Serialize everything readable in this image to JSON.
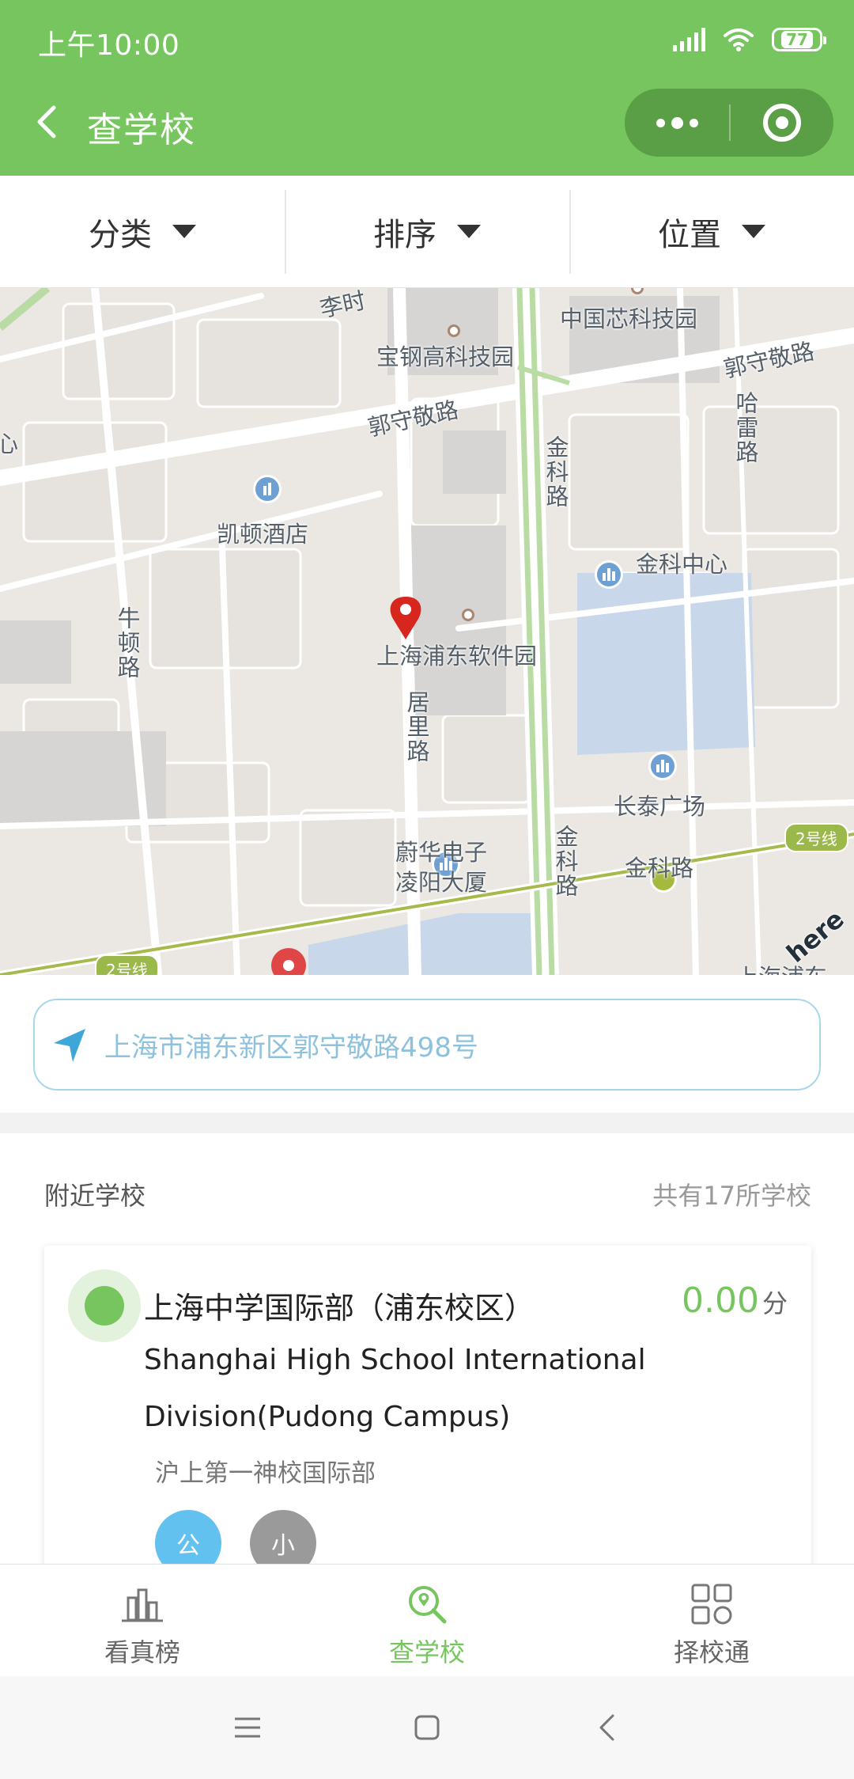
{
  "status": {
    "time": "上午10:00",
    "battery": "77"
  },
  "header": {
    "title": "查学校"
  },
  "filters": [
    {
      "label": "分类"
    },
    {
      "label": "排序"
    },
    {
      "label": "位置"
    }
  ],
  "map": {
    "labels": {
      "lixi": "李时",
      "zhongguoxin": "中国芯科技园",
      "baogang": "宝钢高科技园",
      "guoshoujing_ne": "郭守敬路",
      "guoshoujing_mid": "郭守敬路",
      "kaidun": "凯顿酒店",
      "halei": "哈雷路",
      "jinke_road_1": "金科路",
      "jinke_center": "金科中心",
      "niudun": "牛顿路",
      "pudong_soft": "上海浦东软件园",
      "juli": "居里路",
      "changtai": "长泰广场",
      "weihua": "蔚华电子",
      "lingyang": "凌阳大厦",
      "jinke_road_2": "金科路",
      "jinke_station": "金科路",
      "line2_a": "2号线",
      "line2_b": "2号线",
      "left_edge": "心",
      "bottom_right": "上海浦东",
      "here": "here"
    }
  },
  "address": {
    "text": "上海市浦东新区郭守敬路498号"
  },
  "list": {
    "title": "附近学校",
    "count": "共有17所学校",
    "schools": [
      {
        "name": "上海中学国际部（浦东校区）",
        "score": "0.00",
        "score_unit": "分",
        "name_en_line1": "Shanghai High School International",
        "name_en_line2": "Division(Pudong Campus)",
        "desc": "沪上第一神校国际部",
        "tags": [
          "公",
          "小"
        ]
      }
    ]
  },
  "tabs": [
    {
      "label": "看真榜",
      "icon": "bar-chart-icon"
    },
    {
      "label": "查学校",
      "icon": "search-location-icon"
    },
    {
      "label": "择校通",
      "icon": "grid-icon"
    }
  ],
  "colors": {
    "brand_green": "#76c55e",
    "capsule": "#5a9f45",
    "address_blue": "#8ec2dc",
    "tag_blue": "#62c1ef",
    "tag_gray": "#9a9a9a",
    "pin_red": "#d7261d"
  }
}
